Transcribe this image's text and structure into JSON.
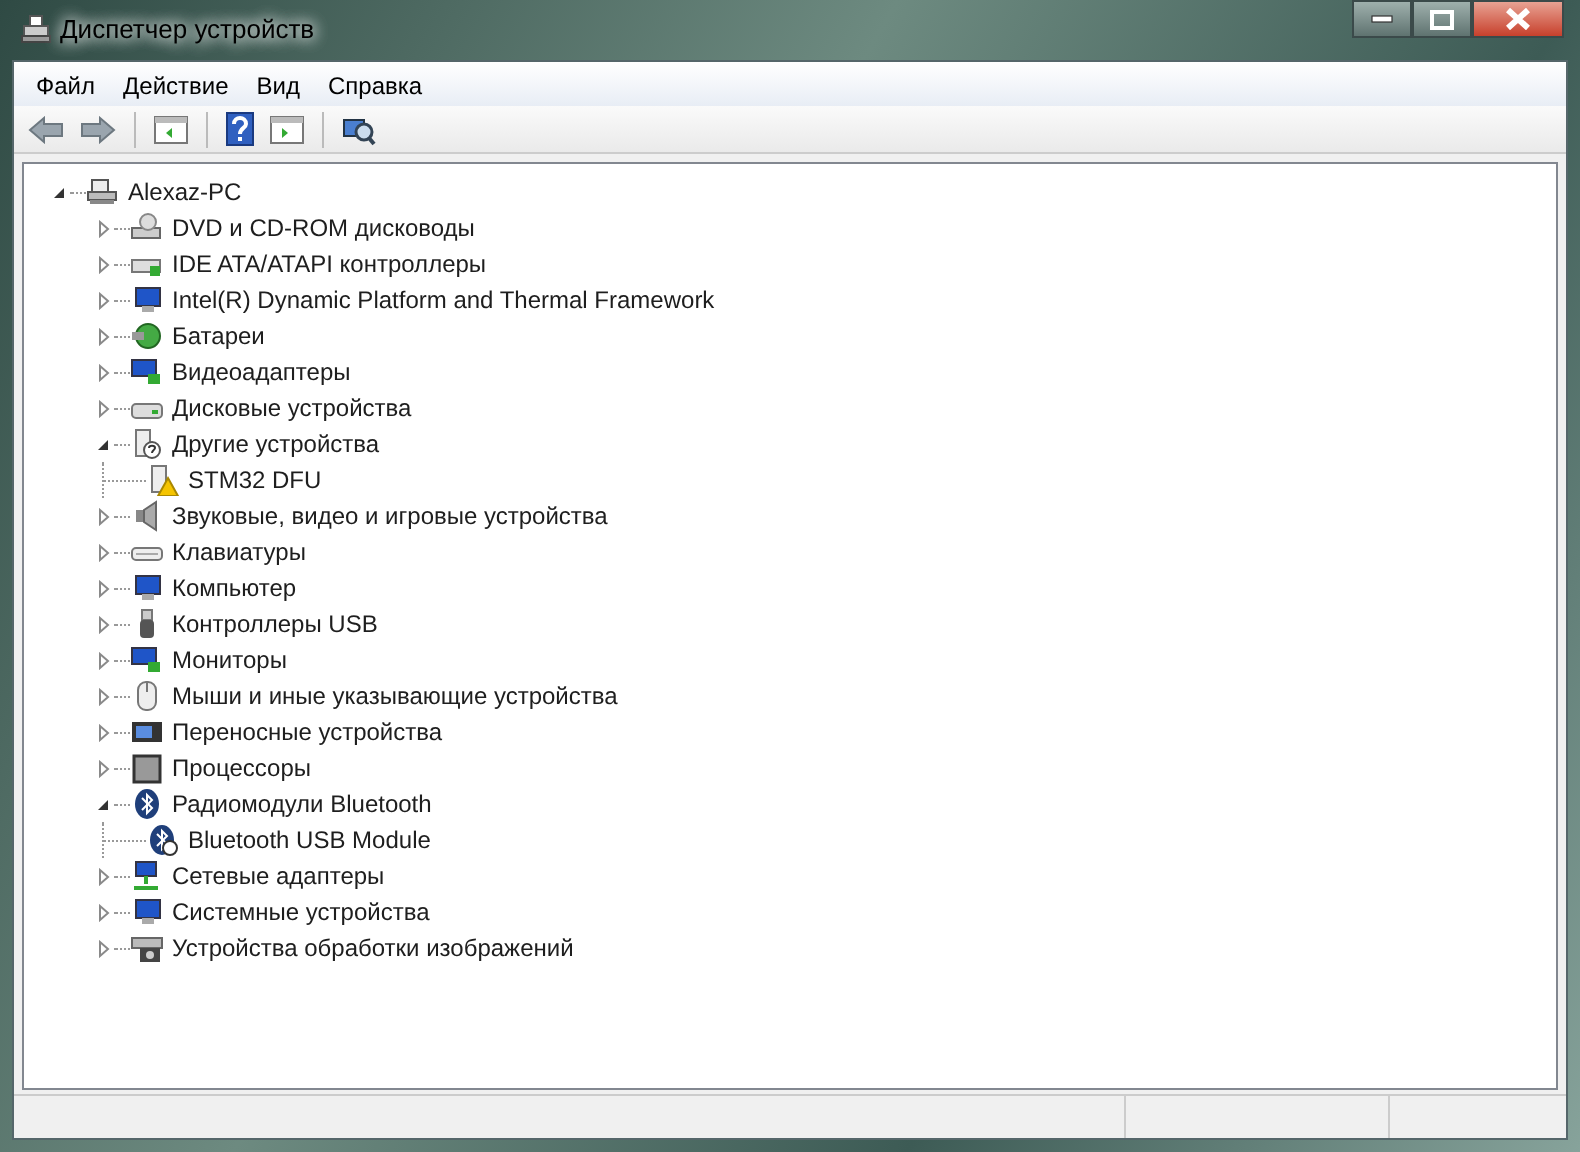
{
  "window": {
    "title": "Диспетчер устройств"
  },
  "menu": [
    "Файл",
    "Действие",
    "Вид",
    "Справка"
  ],
  "tree": {
    "label": "Alexaz-PC",
    "kind": "computer",
    "expanded": true,
    "children": [
      {
        "label": "DVD и CD-ROM дисководы",
        "kind": "optical",
        "expanded": false
      },
      {
        "label": "IDE ATA/ATAPI контроллеры",
        "kind": "controller",
        "expanded": false
      },
      {
        "label": "Intel(R) Dynamic Platform and Thermal Framework",
        "kind": "system",
        "expanded": false
      },
      {
        "label": "Батареи",
        "kind": "battery",
        "expanded": false
      },
      {
        "label": "Видеоадаптеры",
        "kind": "display",
        "expanded": false
      },
      {
        "label": "Дисковые устройства",
        "kind": "disk",
        "expanded": false
      },
      {
        "label": "Другие устройства",
        "kind": "unknown",
        "expanded": true,
        "children": [
          {
            "label": "STM32 DFU",
            "kind": "warning"
          }
        ]
      },
      {
        "label": "Звуковые, видео и игровые устройства",
        "kind": "sound",
        "expanded": false
      },
      {
        "label": "Клавиатуры",
        "kind": "keyboard",
        "expanded": false
      },
      {
        "label": "Компьютер",
        "kind": "system",
        "expanded": false
      },
      {
        "label": "Контроллеры USB",
        "kind": "usb",
        "expanded": false
      },
      {
        "label": "Мониторы",
        "kind": "display",
        "expanded": false
      },
      {
        "label": "Мыши и иные указывающие устройства",
        "kind": "mouse",
        "expanded": false
      },
      {
        "label": "Переносные устройства",
        "kind": "portable",
        "expanded": false
      },
      {
        "label": "Процессоры",
        "kind": "cpu",
        "expanded": false
      },
      {
        "label": "Радиомодули Bluetooth",
        "kind": "bluetooth",
        "expanded": true,
        "children": [
          {
            "label": "Bluetooth USB Module",
            "kind": "bluetooth-device"
          }
        ]
      },
      {
        "label": "Сетевые адаптеры",
        "kind": "network",
        "expanded": false
      },
      {
        "label": "Системные устройства",
        "kind": "system",
        "expanded": false
      },
      {
        "label": "Устройства обработки изображений",
        "kind": "camera",
        "expanded": false
      }
    ]
  }
}
